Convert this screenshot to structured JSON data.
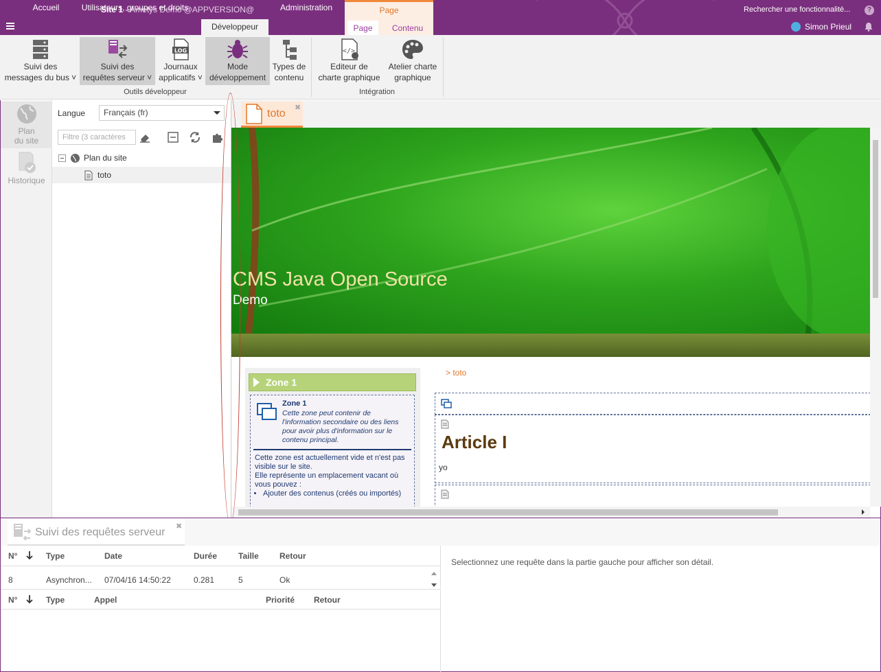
{
  "topbar": {
    "site": "Site 1",
    "app": "Ametys Demo @APPVERSION@",
    "search": "Rechercher une fonctionnalité...",
    "help": "?",
    "user": "Simon Prieul",
    "tabs": [
      {
        "label": "Accueil"
      },
      {
        "label": "Utilisateurs, groupes et droits"
      },
      {
        "label": "Développeur"
      },
      {
        "label": "Administration"
      }
    ],
    "context": {
      "title": "Page",
      "tabs": [
        {
          "label": "Page"
        },
        {
          "label": "Contenu"
        }
      ]
    }
  },
  "ribbon": {
    "buttons": [
      {
        "label": "Suivi des\nmessages du bus ˅"
      },
      {
        "label": "Suivi des\nrequêtes serveur ˅"
      },
      {
        "label": "Journaux\napplicatifs ˅"
      },
      {
        "label": "Mode\ndéveloppement"
      },
      {
        "label": "Types de\ncontenu"
      },
      {
        "label": "Editeur de\ncharte graphique"
      },
      {
        "label": "Atelier charte\ngraphique"
      }
    ],
    "groups": [
      {
        "label": "Outils développeur"
      },
      {
        "label": "Intégration"
      }
    ]
  },
  "lefttools": [
    {
      "label": "Plan\ndu site"
    },
    {
      "label": "Historique"
    }
  ],
  "tree": {
    "lang_label": "Langue",
    "lang_value": "Français (fr)",
    "filter_placeholder": "Filtre (3 caractères",
    "nodes": [
      {
        "label": "Plan du site"
      },
      {
        "label": "toto"
      }
    ]
  },
  "doc": {
    "tab": "toto",
    "banner_title": "CMS Java Open Source",
    "banner_sub": "Demo",
    "zone_head": "Zone 1",
    "zone_title": "Zone 1",
    "zone_desc": "Cette zone peut contenir de l'information secondaire ou des liens pour avoir plus d'information sur le contenu principal.",
    "zone_body": "Cette zone est actuellement vide et n'est pas visible sur le site.\nElle représente un emplacement vacant où vous pouvez :",
    "zone_item": "Ajouter des contenus (créés ou importés)",
    "crumb": "> toto",
    "article_title": "Article I",
    "article_text": "yo"
  },
  "bottom": {
    "tab": "Suivi des requêtes serveur",
    "grid1_headers": [
      "N°",
      "Type",
      "Date",
      "Durée",
      "Taille",
      "Retour"
    ],
    "grid1_rows": [
      {
        "n": "8",
        "type": "Asynchron...",
        "date": "07/04/16 14:50:22",
        "duree": "0.281",
        "taille": "5",
        "retour": "Ok"
      }
    ],
    "grid2_headers": [
      "N°",
      "Type",
      "Appel",
      "Priorité",
      "Retour"
    ],
    "detail": "Selectionnez une requête dans la partie gauche pour afficher son détail."
  }
}
